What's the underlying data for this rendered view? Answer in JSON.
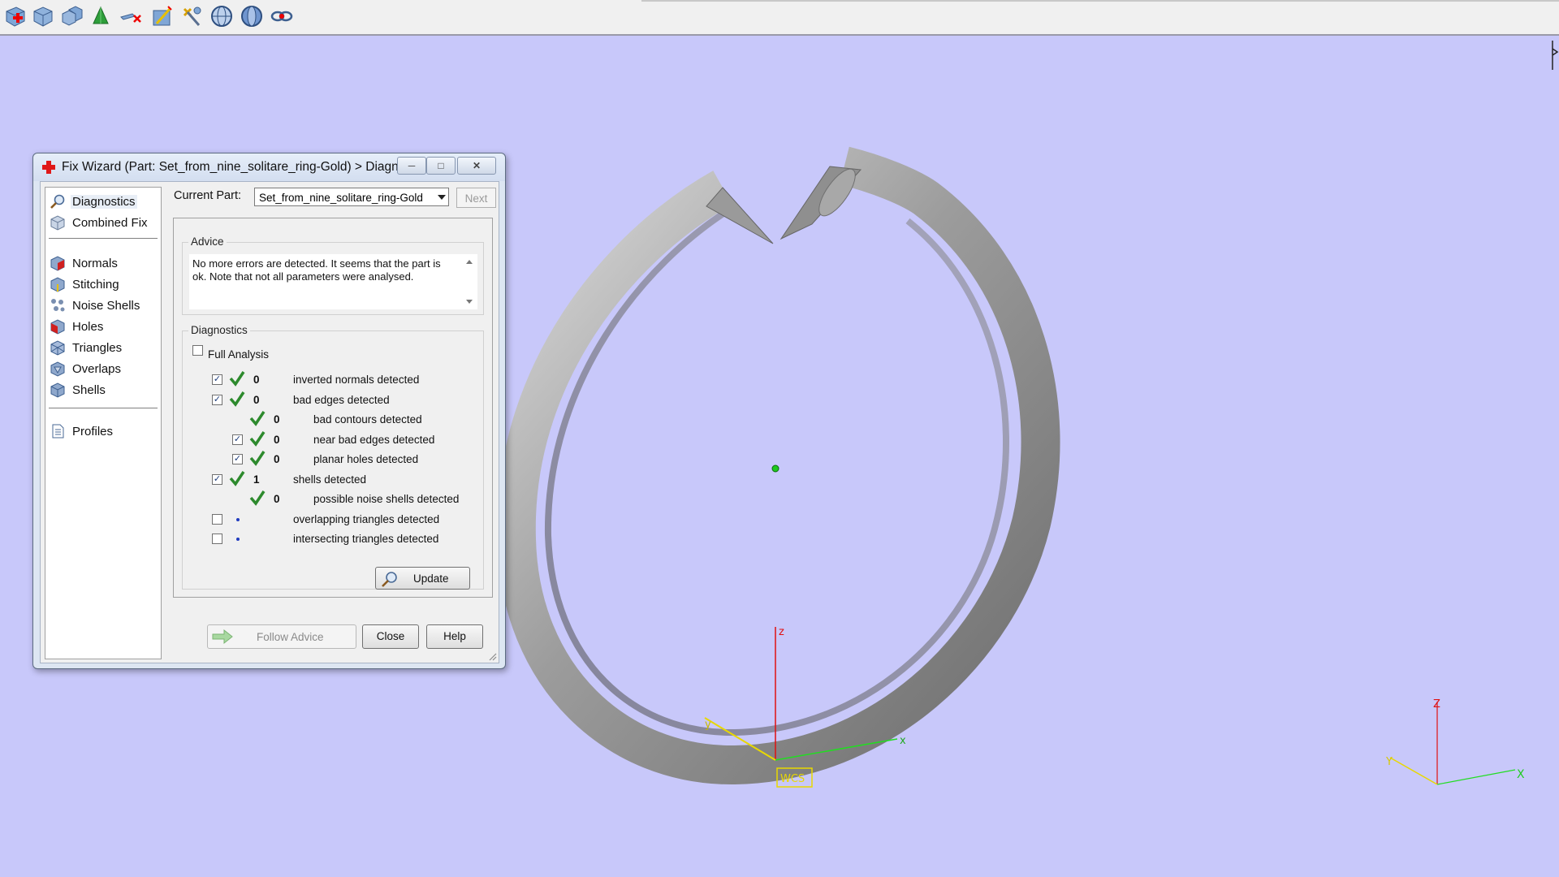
{
  "toolbar": {
    "icons": [
      "add-part-icon",
      "part-box-icon",
      "parts-stack-icon",
      "green-cone-icon",
      "remove-icon",
      "wand-edit-icon",
      "tools-icon",
      "sphere-grid-icon",
      "sphere-shade-icon",
      "link-icon"
    ]
  },
  "dialog": {
    "title": "Fix Wizard (Part: Set_from_nine_solitare_ring-Gold) > Diagnos...",
    "nav": {
      "items_top": [
        {
          "label": "Diagnostics",
          "icon": "magnifier-icon",
          "selected": true
        },
        {
          "label": "Combined Fix",
          "icon": "box-icon"
        }
      ],
      "items_mid": [
        {
          "label": "Normals",
          "icon": "normals-cube-icon"
        },
        {
          "label": "Stitching",
          "icon": "stitching-cube-icon"
        },
        {
          "label": "Noise Shells",
          "icon": "noise-shells-icon"
        },
        {
          "label": "Holes",
          "icon": "holes-cube-icon"
        },
        {
          "label": "Triangles",
          "icon": "triangles-cube-icon"
        },
        {
          "label": "Overlaps",
          "icon": "overlaps-cube-icon"
        },
        {
          "label": "Shells",
          "icon": "shells-cube-icon"
        }
      ],
      "items_bottom": [
        {
          "label": "Profiles",
          "icon": "document-icon"
        }
      ]
    },
    "current_part_label": "Current Part:",
    "current_part_value": "Set_from_nine_solitare_ring-Gold",
    "next_label": "Next",
    "advice_title": "Advice",
    "advice_text": "No more errors are detected. It seems that the part is ok. Note that not all parameters were analysed.",
    "diagnostics_title": "Diagnostics",
    "full_analysis_label": "Full Analysis",
    "full_analysis_checked": false,
    "rows": [
      {
        "checkbox": true,
        "checked": true,
        "status": "ok",
        "count": "0",
        "text": "inverted normals detected",
        "indent": 0
      },
      {
        "checkbox": true,
        "checked": true,
        "status": "ok",
        "count": "0",
        "text": "bad edges detected",
        "indent": 0
      },
      {
        "checkbox": false,
        "checked": false,
        "status": "ok",
        "count": "0",
        "text": "bad contours detected",
        "indent": 1
      },
      {
        "checkbox": true,
        "checked": true,
        "status": "ok",
        "count": "0",
        "text": "near bad edges detected",
        "indent": 1
      },
      {
        "checkbox": true,
        "checked": true,
        "status": "ok",
        "count": "0",
        "text": "planar holes detected",
        "indent": 1
      },
      {
        "checkbox": true,
        "checked": true,
        "status": "ok",
        "count": "1",
        "text": "shells detected",
        "indent": 0
      },
      {
        "checkbox": false,
        "checked": false,
        "status": "ok",
        "count": "0",
        "text": "possible noise shells detected",
        "indent": 1
      },
      {
        "checkbox": true,
        "checked": false,
        "status": "pending",
        "count": "",
        "text": "overlapping triangles detected",
        "indent": 0
      },
      {
        "checkbox": true,
        "checked": false,
        "status": "pending",
        "count": "",
        "text": "intersecting triangles detected",
        "indent": 0
      }
    ],
    "update_label": "Update",
    "follow_advice_label": "Follow Advice",
    "close_label": "Close",
    "help_label": "Help"
  },
  "viewport": {
    "background": "#c8c8fa",
    "wcs_label": "WCS",
    "axis_labels": {
      "x": "x",
      "y": "y",
      "z": "z",
      "X": "X",
      "Y": "Y",
      "Z": "Z"
    }
  },
  "colors": {
    "check_green": "#2d8a2d",
    "axis_x": "#22dd22",
    "axis_y": "#e8d800",
    "axis_z": "#e01010",
    "wcs": "#e8d800"
  }
}
